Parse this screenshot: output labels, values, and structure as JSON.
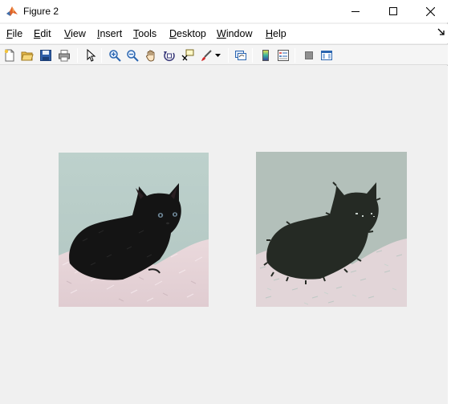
{
  "window": {
    "title": "Figure 2",
    "controls": {
      "minimize": "minimize",
      "maximize": "maximize",
      "close": "close"
    }
  },
  "menu": [
    {
      "key": "F",
      "rest": "ile"
    },
    {
      "key": "E",
      "rest": "dit"
    },
    {
      "key": "V",
      "rest": "iew"
    },
    {
      "key": "I",
      "rest": "nsert"
    },
    {
      "key": "T",
      "rest": "ools"
    },
    {
      "key": "D",
      "rest": "esktop"
    },
    {
      "key": "W",
      "rest": "indow"
    },
    {
      "key": "H",
      "rest": "elp"
    }
  ],
  "toolbar": {
    "buttons": [
      "new-figure-icon",
      "open-file-icon",
      "save-icon",
      "print-icon",
      "edit-plot-icon",
      "zoom-in-icon",
      "zoom-out-icon",
      "pan-icon",
      "rotate-3d-icon",
      "data-cursor-icon",
      "brush-icon",
      "brush-dropdown-icon",
      "link-plot-icon",
      "colorbar-icon",
      "legend-icon",
      "hide-plot-tools-icon",
      "show-plot-tools-icon"
    ]
  },
  "figure": {
    "images": [
      {
        "name": "original-kitten-image",
        "description": "original"
      },
      {
        "name": "segmented-kitten-image",
        "description": "segmented"
      }
    ]
  },
  "colors": {
    "titlebar_bg": "#ffffff",
    "figure_bg": "#f0f0f0",
    "wall": "#b8ccc8",
    "blanket": "#e7d5d8",
    "cat": "#151515",
    "wall_seg": "#b3c0ba",
    "blanket_seg": "#e2d5d8",
    "cat_seg": "#252a24"
  }
}
